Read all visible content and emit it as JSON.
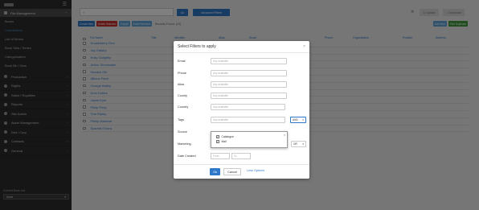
{
  "sidebar": {
    "section_title": "File Management",
    "sub_items": [
      {
        "label": "Books",
        "active": false
      },
      {
        "label": "Contributors",
        "active": true
      },
      {
        "label": "List of Works",
        "active": false
      },
      {
        "label": "Book Sets / Series",
        "active": false
      },
      {
        "label": "Categorisation",
        "active": false
      },
      {
        "label": "Book Bk / Slow",
        "active": false
      }
    ],
    "items": [
      {
        "label": "Production"
      },
      {
        "label": "Rights"
      },
      {
        "label": "Sales / Royalties"
      },
      {
        "label": "Reports"
      },
      {
        "label": "Site Admin"
      },
      {
        "label": "Asset Management"
      },
      {
        "label": "Dist / Corp"
      },
      {
        "label": "Contacts"
      },
      {
        "label": "General"
      }
    ],
    "footer_label": "Current Book List",
    "footer_select": "None"
  },
  "toolbar": {
    "search_placeholder": "",
    "go_label": "Go",
    "advanced_label": "Advanced Filters",
    "update_label": "Update",
    "download_label": "Download"
  },
  "actions": {
    "new_label": "Create New",
    "delete_label": "Delete Selected",
    "export_label": "Export",
    "email_label": "Email Selected",
    "found_text": "Records Found: (15)",
    "right_buttons": [
      "Add New",
      "Find Duplicate"
    ]
  },
  "table": {
    "headers": [
      "Full Name",
      "Title",
      "Identifier",
      "Alias",
      "Email",
      "Phone",
      "Organisation",
      "Position",
      "Address"
    ],
    "rows": [
      "Huckleberry Finn",
      "Jay Gatsby",
      "Holly Golightly",
      "Arthur Dimmsdale",
      "Hamish Gill",
      "Atticus Finch",
      "George Bailey",
      "Dom Dobbs",
      "Jayne Eyre",
      "Philip Pirrip",
      "Tom Ripley",
      "Phillip Marlowe",
      "Scarlett O'hara"
    ]
  },
  "modal": {
    "title": "Select Filters to apply",
    "close_glyph": "×",
    "fields": [
      {
        "label": "Email",
        "placeholder": "Any available"
      },
      {
        "label": "Phone",
        "placeholder": "Any available"
      },
      {
        "label": "Alias",
        "placeholder": "Any available"
      },
      {
        "label": "County",
        "placeholder": "Any available"
      },
      {
        "label": "Country",
        "placeholder": "Any available"
      },
      {
        "label": "Tags",
        "placeholder": "Any available"
      },
      {
        "label": "Source",
        "placeholder": ""
      },
      {
        "label": "Marketing",
        "placeholder": ""
      },
      {
        "label": "Date Created",
        "placeholder": ""
      }
    ],
    "tags_operator": "AND",
    "marketing_operator": "OR",
    "dropdown_options": [
      {
        "label": "Catalogue",
        "checked": true
      },
      {
        "label": "Mail",
        "checked": true
      }
    ],
    "date_from_placeholder": "From",
    "date_to_placeholder": "To",
    "ok_label": "Ok",
    "cancel_label": "Cancel",
    "less_label": "Less Options"
  },
  "colors": {
    "accent": "#2f78c9",
    "danger": "#c9302c",
    "success": "#3f9b3f",
    "sidebar_bg": "#2d2d2d"
  }
}
